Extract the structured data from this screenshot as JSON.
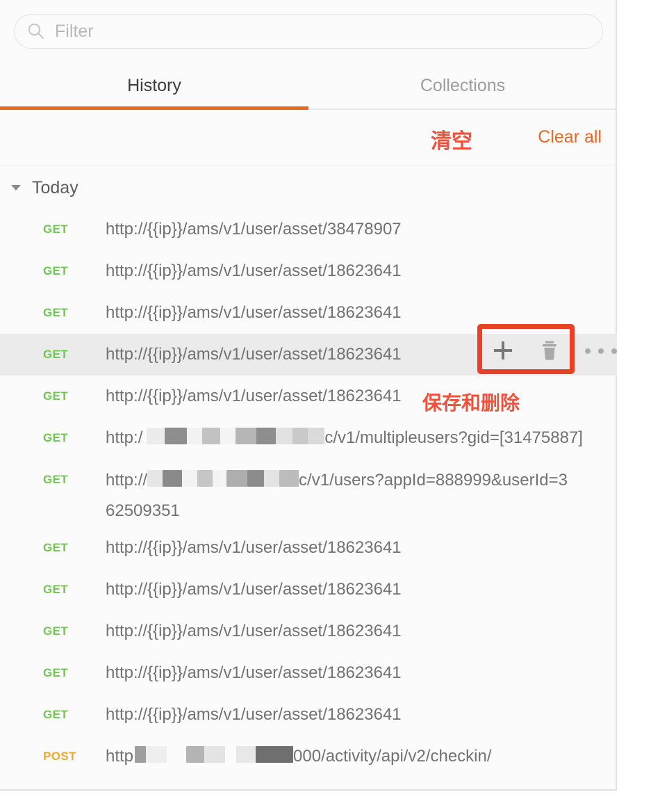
{
  "search": {
    "placeholder": "Filter",
    "value": "",
    "icon": "search-icon"
  },
  "tabs": [
    {
      "label": "History",
      "active": true
    },
    {
      "label": "Collections",
      "active": false
    }
  ],
  "toolbar": {
    "clear_all_label": "Clear all"
  },
  "group": {
    "label": "Today",
    "expanded": true
  },
  "row_actions": {
    "save_icon": "plus-icon",
    "delete_icon": "trash-icon",
    "more_icon": "ellipsis-icon"
  },
  "annotations": [
    {
      "id": "clear",
      "text": "清空",
      "color": "#f1503a"
    },
    {
      "id": "save-delete",
      "text": "保存和删除",
      "color": "#f1503a"
    },
    {
      "id": "action-box",
      "type": "rectangle",
      "color": "#ea4025"
    }
  ],
  "colors": {
    "accent": "#ec6720",
    "get_method": "#6dc94c",
    "post_method": "#f5a623",
    "annotation_red": "#f1503a",
    "selected_row": "#ebebeb",
    "panel_background": "#fbfbfb"
  },
  "history": [
    {
      "method": "GET",
      "url": "http://{{ip}}/ams/v1/user/asset/38478907",
      "redacted": false,
      "selected": false
    },
    {
      "method": "GET",
      "url": "http://{{ip}}/ams/v1/user/asset/18623641",
      "redacted": false,
      "selected": false
    },
    {
      "method": "GET",
      "url": "http://{{ip}}/ams/v1/user/asset/18623641",
      "redacted": false,
      "selected": false
    },
    {
      "method": "GET",
      "url": "http://{{ip}}/ams/v1/user/asset/18623641",
      "redacted": false,
      "selected": true
    },
    {
      "method": "GET",
      "url": "http://{{ip}}/ams/v1/user/asset/18623641",
      "redacted": false,
      "selected": false
    },
    {
      "method": "GET",
      "url": "http://███████████c/v1/multipleusers?gid=[31475887]",
      "redacted": true,
      "selected": false
    },
    {
      "method": "GET",
      "url": "http://██████████c/v1/users?appId=888999&userId=362509351",
      "redacted": true,
      "selected": false
    },
    {
      "method": "GET",
      "url": "http://{{ip}}/ams/v1/user/asset/18623641",
      "redacted": false,
      "selected": false
    },
    {
      "method": "GET",
      "url": "http://{{ip}}/ams/v1/user/asset/18623641",
      "redacted": false,
      "selected": false
    },
    {
      "method": "GET",
      "url": "http://{{ip}}/ams/v1/user/asset/18623641",
      "redacted": false,
      "selected": false
    },
    {
      "method": "GET",
      "url": "http://{{ip}}/ams/v1/user/asset/18623641",
      "redacted": false,
      "selected": false
    },
    {
      "method": "GET",
      "url": "http://{{ip}}/ams/v1/user/asset/18623641",
      "redacted": false,
      "selected": false
    },
    {
      "method": "POST",
      "url": "http█████████000/activity/api/v2/checkin/",
      "redacted": true,
      "selected": false
    }
  ],
  "history_display": {
    "row_5_visible": "http:/",
    "row_5_tail": "c/v1/multipleusers?gid=[31475887]",
    "row_6_visible": "http://",
    "row_6_tail": "c/v1/users?appId=888999&userId=3",
    "row_6_line2": "62509351",
    "row_12_visible": "http",
    "row_12_tail": "000/activity/api/v2/checkin/"
  }
}
